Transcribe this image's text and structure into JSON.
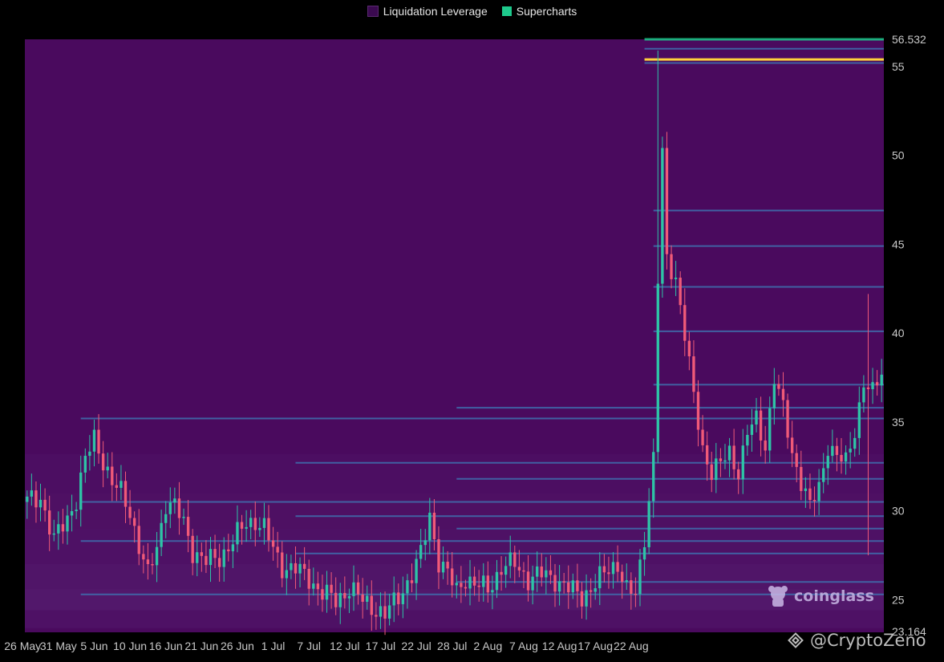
{
  "legend": [
    {
      "label": "Liquidation Leverage",
      "color": "#3b0a50"
    },
    {
      "label": "Supercharts",
      "color": "#1ec98c"
    }
  ],
  "watermark": {
    "brand": "coinglass",
    "credit": "@CryptoZeno"
  },
  "colors": {
    "background": "#4a0a5e",
    "up": "#2ec4a6",
    "down": "#f05a78",
    "heat_line": "#3f6fae",
    "max_line": "#ffd23c"
  },
  "chart_data": {
    "type": "candlestick-heatmap",
    "title": "",
    "xlabel": "",
    "ylabel": "",
    "ylim": [
      23.164,
      56.532
    ],
    "y_ticks": [
      25,
      30,
      35,
      40,
      45,
      50,
      55
    ],
    "y_extreme_labels": [
      "56.532",
      "23.164"
    ],
    "x_ticks": [
      "26 May",
      "31 May",
      "5 Jun",
      "10 Jun",
      "16 Jun",
      "21 Jun",
      "26 Jun",
      "1 Jul",
      "7 Jul",
      "12 Jul",
      "17 Jul",
      "22 Jul",
      "28 Jul",
      "2 Aug",
      "7 Aug",
      "12 Aug",
      "17 Aug",
      "22 Aug"
    ],
    "x_tick_index": [
      -1,
      7,
      15,
      23,
      31,
      39,
      47,
      55,
      63,
      71,
      79,
      87,
      95,
      103,
      111,
      119,
      127,
      135
    ],
    "price_path": [
      [
        0,
        30.5
      ],
      [
        3,
        30.8
      ],
      [
        6,
        28.3
      ],
      [
        9,
        29.6
      ],
      [
        11,
        30.7
      ],
      [
        13,
        32.8
      ],
      [
        15,
        34.1
      ],
      [
        17,
        32.9
      ],
      [
        19,
        31.5
      ],
      [
        21,
        31.0
      ],
      [
        23,
        30.0
      ],
      [
        25,
        28.0
      ],
      [
        27,
        26.3
      ],
      [
        29,
        28.0
      ],
      [
        31,
        30.5
      ],
      [
        33,
        30.2
      ],
      [
        35,
        29.3
      ],
      [
        37,
        27.8
      ],
      [
        40,
        27.1
      ],
      [
        43,
        27.4
      ],
      [
        46,
        28.3
      ],
      [
        49,
        29.3
      ],
      [
        51,
        29.5
      ],
      [
        53,
        29.0
      ],
      [
        55,
        27.8
      ],
      [
        57,
        26.9
      ],
      [
        60,
        26.7
      ],
      [
        63,
        26.2
      ],
      [
        66,
        25.4
      ],
      [
        69,
        24.9
      ],
      [
        72,
        25.7
      ],
      [
        75,
        24.9
      ],
      [
        78,
        24.5
      ],
      [
        80,
        24.1
      ],
      [
        82,
        24.8
      ],
      [
        84,
        25.6
      ],
      [
        86,
        26.4
      ],
      [
        88,
        27.5
      ],
      [
        90,
        29.8
      ],
      [
        92,
        27.2
      ],
      [
        94,
        26.4
      ],
      [
        96,
        25.5
      ],
      [
        98,
        26.3
      ],
      [
        100,
        25.8
      ],
      [
        103,
        25.6
      ],
      [
        106,
        26.8
      ],
      [
        109,
        27.0
      ],
      [
        112,
        26.2
      ],
      [
        115,
        26.4
      ],
      [
        118,
        26.2
      ],
      [
        121,
        25.6
      ],
      [
        124,
        25.2
      ],
      [
        127,
        25.9
      ],
      [
        130,
        26.7
      ],
      [
        132,
        27.1
      ],
      [
        134,
        25.5
      ],
      [
        136,
        25.2
      ],
      [
        138,
        28.6
      ],
      [
        140,
        33.0
      ],
      [
        141,
        43.0
      ],
      [
        142,
        50.0
      ],
      [
        143,
        44.0
      ],
      [
        145,
        43.2
      ],
      [
        147,
        40.0
      ],
      [
        149,
        36.3
      ],
      [
        151,
        33.5
      ],
      [
        153,
        32.3
      ],
      [
        155,
        32.6
      ],
      [
        157,
        33.2
      ],
      [
        159,
        32.3
      ],
      [
        161,
        34.4
      ],
      [
        163,
        35.0
      ],
      [
        165,
        33.7
      ],
      [
        167,
        37.6
      ],
      [
        169,
        35.6
      ],
      [
        171,
        33.2
      ],
      [
        173,
        31.8
      ],
      [
        175,
        30.2
      ],
      [
        177,
        31.2
      ],
      [
        179,
        33.8
      ],
      [
        181,
        33.1
      ],
      [
        183,
        32.6
      ],
      [
        185,
        34.6
      ],
      [
        187,
        37.3
      ],
      [
        189,
        36.5
      ],
      [
        191,
        37.8
      ]
    ],
    "liquidation_levels": [
      56.532,
      56.0,
      55.2,
      46.9,
      44.9,
      42.6,
      40.1,
      37.1,
      35.8,
      35.2,
      32.7,
      31.8,
      30.5,
      29.7,
      29.0,
      28.3,
      27.6,
      26.0,
      25.3
    ],
    "max_leverage_level": 55.4
  }
}
